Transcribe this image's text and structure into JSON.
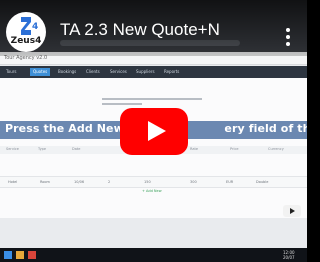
{
  "video": {
    "title": "TA 2.3 New Quote+N",
    "caption": "Press the Add New butt",
    "caption_tail": "ery field of the service",
    "channel": {
      "name": "Zeus4",
      "mark": "4"
    }
  },
  "app": {
    "title": "Tour Agency v2.0",
    "tabs": [
      "Tours",
      "Quotes",
      "Bookings",
      "Clients",
      "Services",
      "Suppliers",
      "Reports"
    ],
    "table_headers": [
      "Service",
      "Type",
      "Date",
      "Quantity",
      "Rate",
      "Price",
      "Currency"
    ],
    "row_values": [
      "Hotel",
      "Room",
      "10/06",
      "2",
      "150",
      "300",
      "EUR",
      "Double"
    ],
    "add_link": "+ Add New"
  },
  "taskbar": {
    "time": "12:00",
    "date": "20/07"
  },
  "colors": {
    "play": "#ff0000",
    "caption_bg": "#4b6ea0",
    "logo_blue": "#2b6fd6"
  }
}
